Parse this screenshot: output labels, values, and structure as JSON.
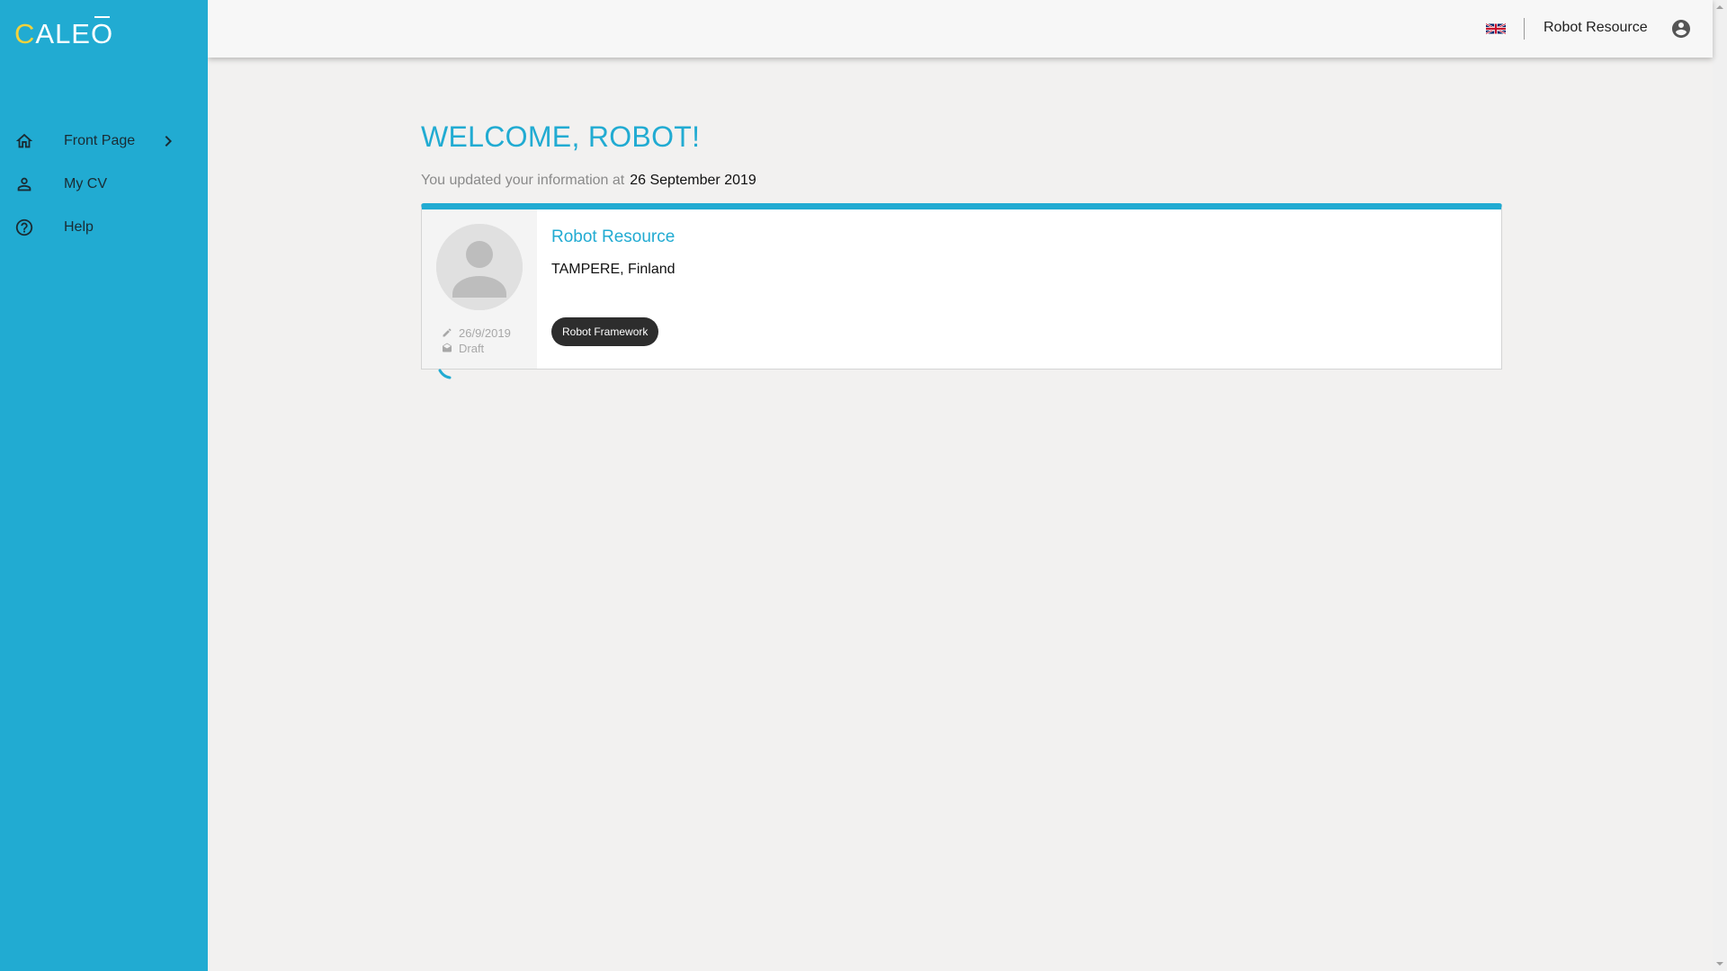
{
  "app": {
    "logo_first": "C",
    "logo_rest": "ALE",
    "logo_last": "O"
  },
  "sidebar": {
    "items": [
      {
        "label": "Front Page",
        "icon": "home-icon",
        "active": true
      },
      {
        "label": "My CV",
        "icon": "person-icon",
        "active": false
      },
      {
        "label": "Help",
        "icon": "help-circle-icon",
        "active": false
      }
    ]
  },
  "header": {
    "language_icon": "uk-flag-icon",
    "user_name": "Robot Resource",
    "account_icon": "account-circle-icon"
  },
  "main": {
    "welcome": "WELCOME, ROBOT!",
    "updated_prefix": "You updated your information at",
    "updated_date": "26 September 2019"
  },
  "card": {
    "name": "Robot Resource",
    "location": "TAMPERE, Finland",
    "edited_date": "26/9/2019",
    "status": "Draft",
    "skills": [
      "Robot Framework"
    ]
  },
  "colors": {
    "accent": "#21abd2",
    "logo_accent": "#f2d23c",
    "tag_bg": "#2d2d2d",
    "page_bg": "#f2f1f0"
  }
}
